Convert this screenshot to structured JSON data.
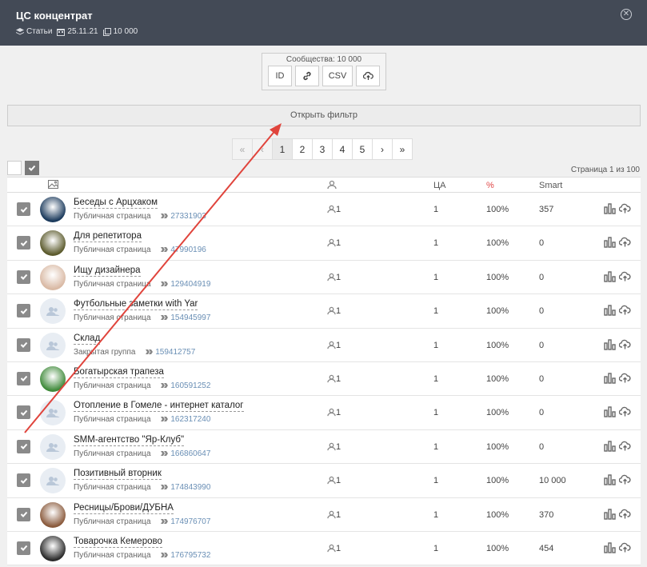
{
  "header": {
    "title": "ЦС концентрат",
    "meta_type": "Статьи",
    "meta_date": "25.11.21",
    "meta_count": "10 000"
  },
  "export": {
    "caption": "Сообщества: 10 000",
    "id_label": "ID",
    "csv_label": "CSV",
    "icons": [
      "link-icon",
      "cloud-upload-icon"
    ]
  },
  "filter": {
    "label": "Открыть фильтр"
  },
  "pagination": {
    "first": "«",
    "prev": "‹",
    "pages": [
      "1",
      "2",
      "3",
      "4",
      "5"
    ],
    "next": "›",
    "last": "»",
    "current": "1"
  },
  "page_info": "Страница 1 из 100",
  "table": {
    "headers": {
      "members": "",
      "ca": "ЦА",
      "pct": "%",
      "smart": "Smart"
    },
    "pct_color": "#e04848",
    "rows": [
      {
        "name": "Беседы с Арцхаком",
        "type": "Публичная страница",
        "id": "27331903",
        "members": "1",
        "ca": "1",
        "pct": "100%",
        "smart": "357",
        "avatar": "photo",
        "color": "#1b3a5c"
      },
      {
        "name": "Для репетитора",
        "type": "Публичная страница",
        "id": "47990196",
        "members": "1",
        "ca": "1",
        "pct": "100%",
        "smart": "0",
        "avatar": "photo",
        "color": "#5b5a2c"
      },
      {
        "name": "Ищу дизайнера",
        "type": "Публичная страница",
        "id": "129404919",
        "members": "1",
        "ca": "1",
        "pct": "100%",
        "smart": "0",
        "avatar": "photo",
        "color": "#d9b9a4"
      },
      {
        "name": "Футбольные заметки with Yar",
        "type": "Публичная страница",
        "id": "154945997",
        "members": "1",
        "ca": "1",
        "pct": "100%",
        "smart": "0",
        "avatar": "placeholder",
        "color": "#e8edf3"
      },
      {
        "name": "Склад",
        "type": "Закрытая группа",
        "id": "159412757",
        "members": "1",
        "ca": "1",
        "pct": "100%",
        "smart": "0",
        "avatar": "placeholder",
        "color": "#e8edf3"
      },
      {
        "name": "Богатырская трапеза",
        "type": "Публичная страница",
        "id": "160591252",
        "members": "1",
        "ca": "1",
        "pct": "100%",
        "smart": "0",
        "avatar": "photo",
        "color": "#3f8a3a"
      },
      {
        "name": "Отопление в Гомеле - интернет каталог",
        "type": "Публичная страница",
        "id": "162317240",
        "members": "1",
        "ca": "1",
        "pct": "100%",
        "smart": "0",
        "avatar": "placeholder",
        "color": "#e8edf3"
      },
      {
        "name": "SMM-агентство \"Яр-Клуб\"",
        "type": "Публичная страница",
        "id": "166860647",
        "members": "1",
        "ca": "1",
        "pct": "100%",
        "smart": "0",
        "avatar": "placeholder",
        "color": "#e8edf3"
      },
      {
        "name": "Позитивный вторник",
        "type": "Публичная страница",
        "id": "174843990",
        "members": "1",
        "ca": "1",
        "pct": "100%",
        "smart": "10 000",
        "avatar": "placeholder",
        "color": "#e8edf3"
      },
      {
        "name": "Ресницы/Брови/ДУБНА",
        "type": "Публичная страница",
        "id": "174976707",
        "members": "1",
        "ca": "1",
        "pct": "100%",
        "smart": "370",
        "avatar": "photo",
        "color": "#8a5a3c"
      },
      {
        "name": "Товарочка Кемерово",
        "type": "Публичная страница",
        "id": "176795732",
        "members": "1",
        "ca": "1",
        "pct": "100%",
        "smart": "454",
        "avatar": "photo",
        "color": "#2a2a2a"
      }
    ]
  },
  "annotation": {
    "arrow_color": "#e0443c"
  }
}
